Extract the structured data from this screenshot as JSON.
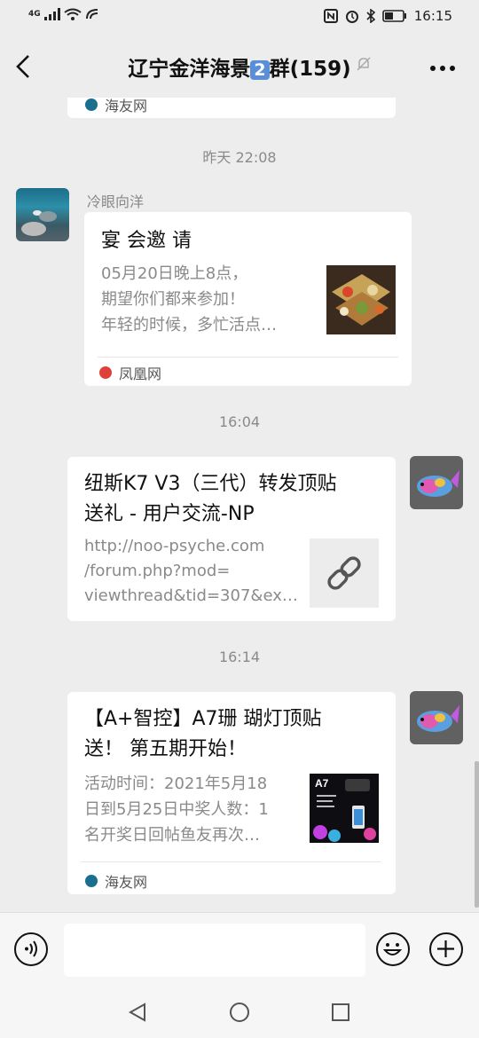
{
  "status_bar": {
    "network": "4G",
    "time": "16:15"
  },
  "header": {
    "title_part1": "辽宁金洋海景",
    "badge": "2",
    "title_part2": "群(159)"
  },
  "messages": [
    {
      "source": "海友网"
    },
    {
      "timestamp": "昨天 22:08",
      "sender": "冷眼向洋",
      "title": "宴 会邀 请",
      "desc": [
        "05月20日晚上8点，",
        "期望你们都来参加！",
        "年轻的时候，多忙活点…"
      ],
      "source": "凤凰网"
    },
    {
      "timestamp": "16:04",
      "title": [
        "纽斯K7 V3（三代）转发顶贴",
        "送礼 - 用户交流-NP"
      ],
      "desc": [
        "http://noo-psyche.com",
        "/forum.php?mod=",
        "viewthread&tid=307&ex…"
      ]
    },
    {
      "timestamp": "16:14",
      "title": [
        "【A+智控】A7珊 瑚灯顶贴",
        "送！ 第五期开始！"
      ],
      "desc": [
        "活动时间：2021年5月18",
        "日到5月25日中奖人数：1",
        "名开奖日回帖鱼友再次…"
      ],
      "thumb_label": "A7",
      "source": "海友网"
    }
  ],
  "icons": {
    "back": "back-arrow-icon",
    "mute": "muted-bell-icon",
    "more": "more-icon",
    "voice": "voice-icon",
    "emoji": "emoji-icon",
    "plus": "plus-icon",
    "link": "link-icon"
  },
  "colors": {
    "background": "#ededed",
    "card": "#ffffff",
    "timestamp": "#8a8a8a",
    "phoenix": "#e0403a",
    "haiyou": "#1a6f8f"
  }
}
